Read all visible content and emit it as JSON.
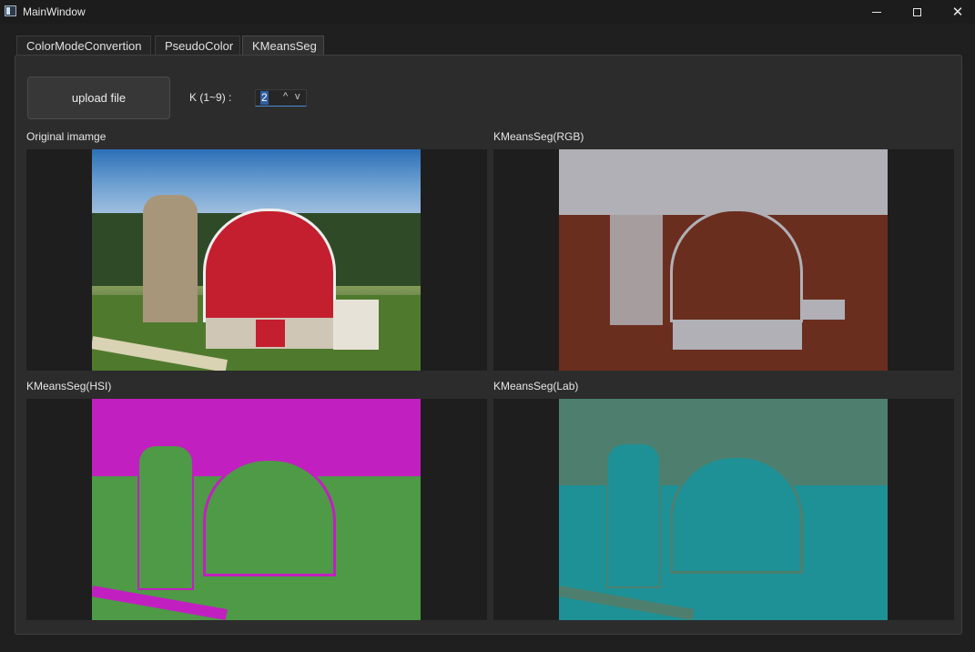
{
  "window": {
    "title": "MainWindow",
    "icon": "app-window-icon",
    "controls": {
      "minimize_icon": "minimize-icon",
      "maximize_icon": "maximize-icon",
      "close_icon": "close-icon",
      "close_glyph": "✕"
    }
  },
  "tabs": [
    {
      "label": "ColorModeConvertion",
      "active": false
    },
    {
      "label": "PseudoColor",
      "active": false
    },
    {
      "label": "KMeansSeg",
      "active": true
    }
  ],
  "toolbar": {
    "upload_label": "upload file",
    "k_label": "K (1~9) :",
    "k_value": "2",
    "k_up_glyph": "^",
    "k_down_glyph": "v"
  },
  "images": {
    "original_label": "Original imamge",
    "rgb_label": "KMeansSeg(RGB)",
    "hsi_label": "KMeansSeg(HSI)",
    "lab_label": "KMeansSeg(Lab)"
  },
  "colors": {
    "accent": "#4a8fd6",
    "rgb_clusters": [
      "#6a2e1f",
      "#b0b0b6"
    ],
    "hsi_clusters": [
      "#4e9a47",
      "#c21fc0"
    ],
    "lab_clusters": [
      "#1d9196",
      "#4e7f6e"
    ]
  }
}
